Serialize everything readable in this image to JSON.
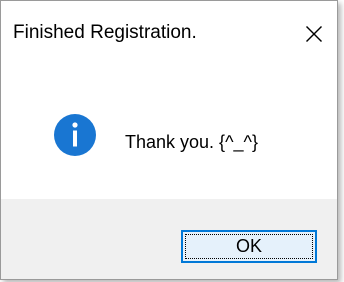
{
  "window": {
    "title": "Finished Registration."
  },
  "titlebar": {
    "close_icon": "close-icon"
  },
  "message": {
    "icon": "info-icon",
    "text": "Thank you. {^_^}"
  },
  "buttons": {
    "ok_label": "OK"
  },
  "colors": {
    "icon_blue": "#1976d2",
    "focus_border": "#0078d7",
    "button_bg": "#e5f1fb",
    "footer_bg": "#f0f0f0"
  }
}
